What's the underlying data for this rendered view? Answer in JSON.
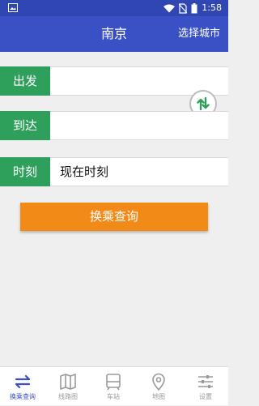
{
  "status_bar": {
    "time": "1:58"
  },
  "header": {
    "title": "南京",
    "city_link": "选择城市"
  },
  "form": {
    "from_label": "出发",
    "from_value": "",
    "to_label": "到达",
    "to_value": "",
    "time_label": "时刻",
    "time_value": "现在时刻"
  },
  "search_button": "换乘查询",
  "bottom_nav": [
    {
      "label": "换乘查询",
      "icon": "transfer-icon",
      "active": true
    },
    {
      "label": "线路图",
      "icon": "map-book-icon",
      "active": false
    },
    {
      "label": "车站",
      "icon": "station-icon",
      "active": false
    },
    {
      "label": "地图",
      "icon": "location-pin-icon",
      "active": false
    },
    {
      "label": "设置",
      "icon": "settings-sliders-icon",
      "active": false
    }
  ],
  "colors": {
    "app_bar": "#3a51c5",
    "status_bar": "#2f46b3",
    "label_green": "#2f9f5c",
    "search_orange": "#f28a18",
    "active_blue": "#3a51c5",
    "inactive_gray": "#999999"
  }
}
